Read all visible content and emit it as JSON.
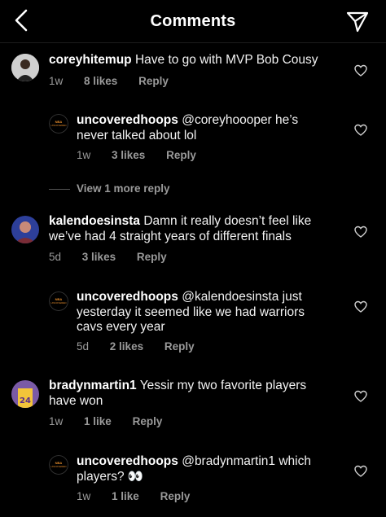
{
  "header": {
    "title": "Comments",
    "back_icon": "chevron-left-icon",
    "send_icon": "paper-plane-icon"
  },
  "comments": [
    {
      "username": "coreyhitemup",
      "text": "Have to go with MVP Bob Cousy",
      "time": "1w",
      "likes": "8 likes",
      "reply": "Reply",
      "avatar": "person-photo-avatar"
    },
    {
      "username": "uncoveredhoops",
      "text": "@coreyhoooper he’s never talked about lol",
      "time": "1w",
      "likes": "3 likes",
      "reply": "Reply",
      "avatar": "uncoveredhoops-logo-avatar",
      "is_reply": true
    },
    {
      "username": "kalendoesinsta",
      "text": "Damn it really doesn’t feel like we’ve had 4 straight years of different finals",
      "time": "5d",
      "likes": "3 likes",
      "reply": "Reply",
      "avatar": "blue-portrait-avatar"
    },
    {
      "username": "uncoveredhoops",
      "text": "@kalendoesinsta just yesterday it seemed like we had warriors cavs every year",
      "time": "5d",
      "likes": "2 likes",
      "reply": "Reply",
      "avatar": "uncoveredhoops-logo-avatar",
      "is_reply": true
    },
    {
      "username": "bradynmartin1",
      "text": "Yessir my two favorite players have won",
      "time": "1w",
      "likes": "1 like",
      "reply": "Reply",
      "avatar": "lakers-jersey-avatar"
    },
    {
      "username": "uncoveredhoops",
      "text": "@bradynmartin1 which players? 👀",
      "time": "1w",
      "likes": "1 like",
      "reply": "Reply",
      "avatar": "uncoveredhoops-logo-avatar",
      "is_reply": true
    }
  ],
  "view_more": "View 1 more reply",
  "colors": {
    "background": "#000000",
    "text": "#ffffff",
    "meta": "#9a9a9a"
  }
}
